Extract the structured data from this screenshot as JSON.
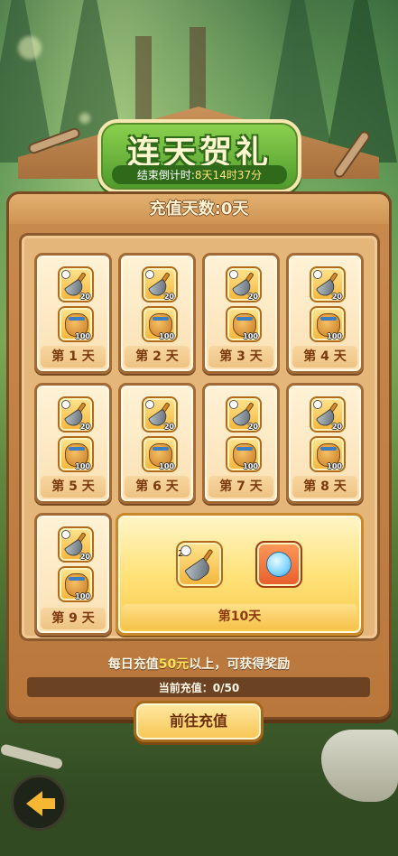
{
  "header": {
    "title": "连天贺礼",
    "countdown_label": "结束倒计时:",
    "countdown_time": "8天14时37分"
  },
  "board": {
    "days_label": "充值天数:0天"
  },
  "days": [
    {
      "label": "第 1 天",
      "shovel_qty": "20",
      "bag_qty": "100"
    },
    {
      "label": "第 2 天",
      "shovel_qty": "20",
      "bag_qty": "100"
    },
    {
      "label": "第 3 天",
      "shovel_qty": "20",
      "bag_qty": "100"
    },
    {
      "label": "第 4 天",
      "shovel_qty": "20",
      "bag_qty": "100"
    },
    {
      "label": "第 5 天",
      "shovel_qty": "20",
      "bag_qty": "100"
    },
    {
      "label": "第 6 天",
      "shovel_qty": "20",
      "bag_qty": "100"
    },
    {
      "label": "第 7 天",
      "shovel_qty": "20",
      "bag_qty": "100"
    },
    {
      "label": "第 8 天",
      "shovel_qty": "20",
      "bag_qty": "100"
    },
    {
      "label": "第 9 天",
      "shovel_qty": "20",
      "bag_qty": "100"
    }
  ],
  "day10": {
    "label": "第10天",
    "shovel_qty": "20"
  },
  "footer": {
    "info_prefix": "每日充值",
    "info_amount": "50元",
    "info_suffix": "以上，可获得奖励",
    "current_label": "当前充值：",
    "current_value": "0/50",
    "recharge_button": "前往充值"
  },
  "icons": {
    "back": "back-arrow-icon",
    "shovel": "shovel-icon",
    "bag": "coin-bag-icon",
    "crystal": "crystal-icon"
  },
  "colors": {
    "title_green": "#4e9a2c",
    "board_wood": "#c98a4d",
    "card_cream": "#fff2d6",
    "accent_yellow": "#f7c553"
  }
}
